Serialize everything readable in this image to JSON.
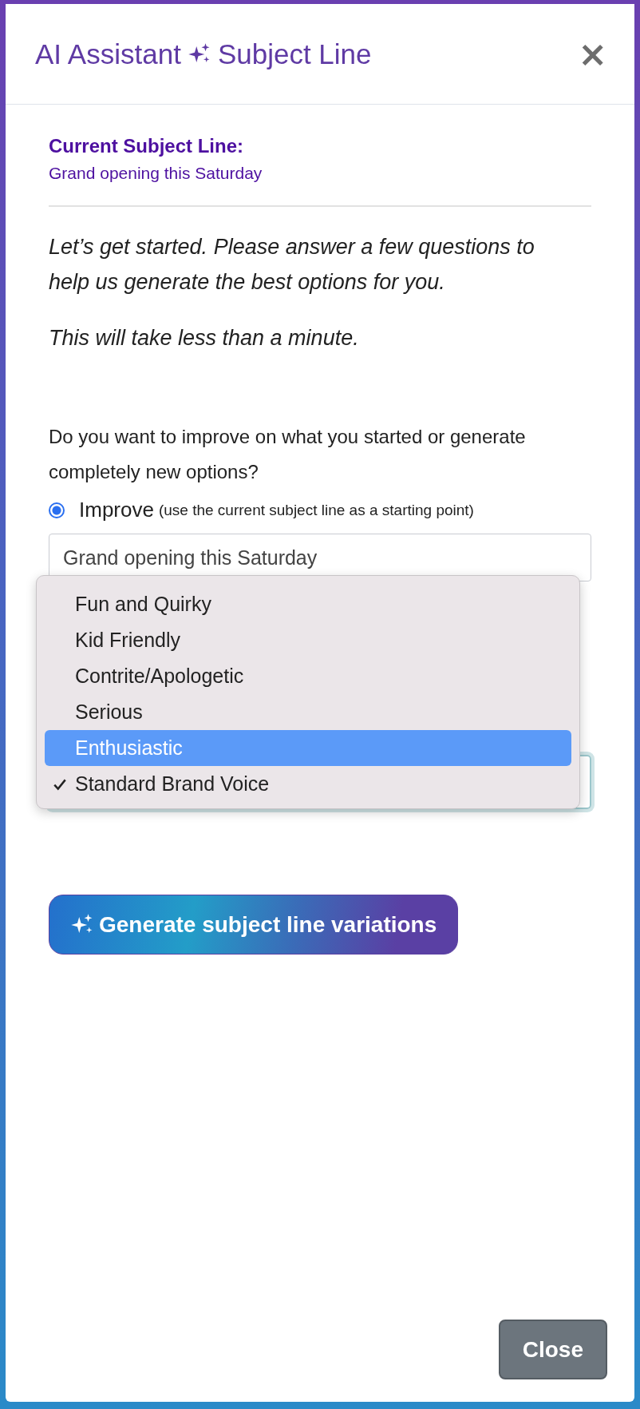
{
  "dialog": {
    "title_start": "AI Assistant",
    "title_end": "Subject Line",
    "close_symbol": "×"
  },
  "current": {
    "heading": "Current Subject Line:",
    "value": "Grand opening this Saturday"
  },
  "intro": [
    "Let’s get started. Please answer a few questions to help us generate the best options for you.",
    "This will take less than a minute."
  ],
  "question": "Do you want to improve on what you started or generate completely new options?",
  "improve_option": {
    "label": "Improve",
    "hint": "(use the current subject line as a starting point)",
    "selected": true
  },
  "subject_field": {
    "value": "Grand opening this Saturday"
  },
  "tone_menu": {
    "options": [
      {
        "label": "Fun and Quirky",
        "selected": false,
        "checked": false
      },
      {
        "label": "Kid Friendly",
        "selected": false,
        "checked": false
      },
      {
        "label": "Contrite/Apologetic",
        "selected": false,
        "checked": false
      },
      {
        "label": "Serious",
        "selected": false,
        "checked": false
      },
      {
        "label": "Enthusiastic",
        "selected": true,
        "checked": false
      },
      {
        "label": "Standard Brand Voice",
        "selected": false,
        "checked": true
      }
    ]
  },
  "generate_button": "Generate subject line variations",
  "close_button": "Close"
}
